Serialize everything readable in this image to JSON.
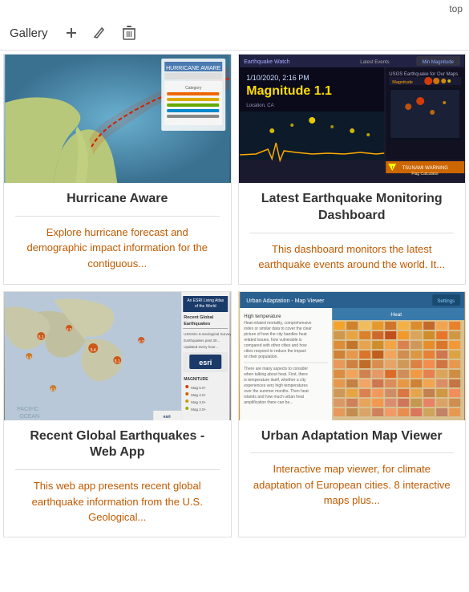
{
  "topbar": {
    "label": "top"
  },
  "gallery": {
    "title": "Gallery",
    "icons": {
      "add": "+",
      "edit": "✏",
      "delete": "🗑"
    }
  },
  "cards": [
    {
      "id": "hurricane-aware",
      "title": "Hurricane Aware",
      "description": "Explore hurricane forecast and demographic impact information for the contiguous...",
      "image_type": "hurricane"
    },
    {
      "id": "earthquake-monitoring",
      "title": "Latest Earthquake Monitoring Dashboard",
      "description": "This dashboard monitors the latest earthquake events around the world. It...",
      "image_type": "earthquake"
    },
    {
      "id": "recent-global-earthquakes",
      "title": "Recent Global Earthquakes - Web App",
      "description": "This web app presents recent global earthquake information from the U.S. Geological...",
      "image_type": "rge"
    },
    {
      "id": "urban-adaptation",
      "title": "Urban Adaptation Map Viewer",
      "description": "Interactive map viewer, for climate adaptation of European cities. 8 interactive maps plus...",
      "image_type": "urban"
    }
  ]
}
